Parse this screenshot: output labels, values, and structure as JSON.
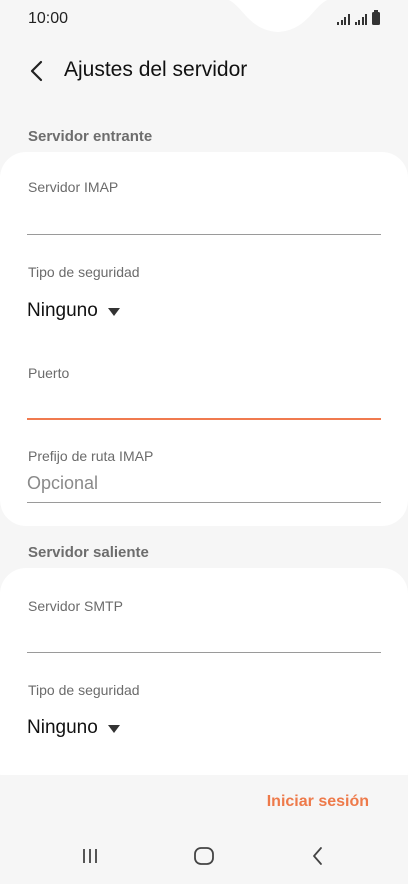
{
  "status_bar": {
    "time": "10:00"
  },
  "header": {
    "title": "Ajustes del servidor"
  },
  "incoming": {
    "section_label": "Servidor entrante",
    "server_label": "Servidor IMAP",
    "server_value": "",
    "security_label": "Tipo de seguridad",
    "security_value": "Ninguno",
    "port_label": "Puerto",
    "port_value": "",
    "prefix_label": "Prefijo de ruta IMAP",
    "prefix_placeholder": "Opcional"
  },
  "outgoing": {
    "section_label": "Servidor saliente",
    "server_label": "Servidor SMTP",
    "server_value": "",
    "security_label": "Tipo de seguridad",
    "security_value": "Ninguno"
  },
  "footer": {
    "sign_in_label": "Iniciar sesión"
  },
  "icons": {
    "back": "chevron-left-icon",
    "caret": "triangle-down-icon",
    "nav_recents": "recents-icon",
    "nav_home": "home-icon",
    "nav_back": "back-icon"
  },
  "colors": {
    "accent": "#ee7a4a",
    "background": "#f6f6f6",
    "card": "#ffffff"
  }
}
